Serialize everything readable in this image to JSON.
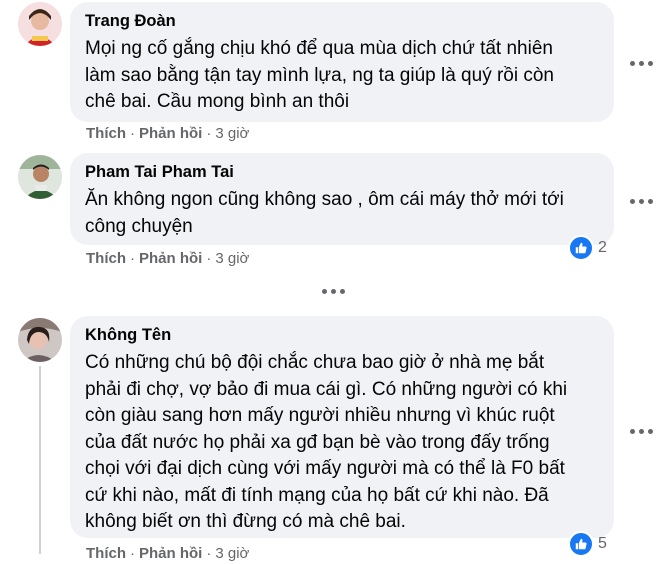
{
  "comments": [
    {
      "author": "Trang Đoàn",
      "text": "Mọi ng cố gắng chịu khó để qua mùa dịch chứ tất nhiên\nlàm sao bằng tận tay mình lựa, ng ta giúp là quý rồi còn\nchê bai. Cầu mong bình an thôi",
      "like_label": "Thích",
      "reply_label": "Phản hồi",
      "time": "3 giờ",
      "reaction_count": ""
    },
    {
      "author": "Pham Tai Pham Tai",
      "text": "Ăn không ngon cũng không sao , ôm cái máy thở mới tới\ncông chuyện",
      "like_label": "Thích",
      "reply_label": "Phản hồi",
      "time": "3 giờ",
      "reaction_count": "2"
    },
    {
      "author": "Không Tên",
      "text": "Có những chú bộ đội chắc chưa bao giờ ở nhà mẹ bắt\nphải đi chợ, vợ bảo đi mua cái gì. Có những người có khi\ncòn giàu sang hơn mấy người nhiều nhưng vì khúc ruột\ncủa đất nước họ phải xa gđ bạn bè vào trong đấy trống\nchọi với đại dịch cùng với mấy người mà có thể là F0 bất\ncứ khi nào, mất đi tính mạng của họ bất cứ khi nào. Đã\nkhông biết ơn thì đừng có mà chê bai.",
      "like_label": "Thích",
      "reply_label": "Phản hồi",
      "time": "3 giờ",
      "reaction_count": "5"
    }
  ],
  "icons": {
    "more": "more-horizontal-icon",
    "like": "thumbs-up-icon"
  },
  "colors": {
    "bubble": "#f0f2f5",
    "secondary_text": "#65676b",
    "like_blue": "#1877f2"
  }
}
